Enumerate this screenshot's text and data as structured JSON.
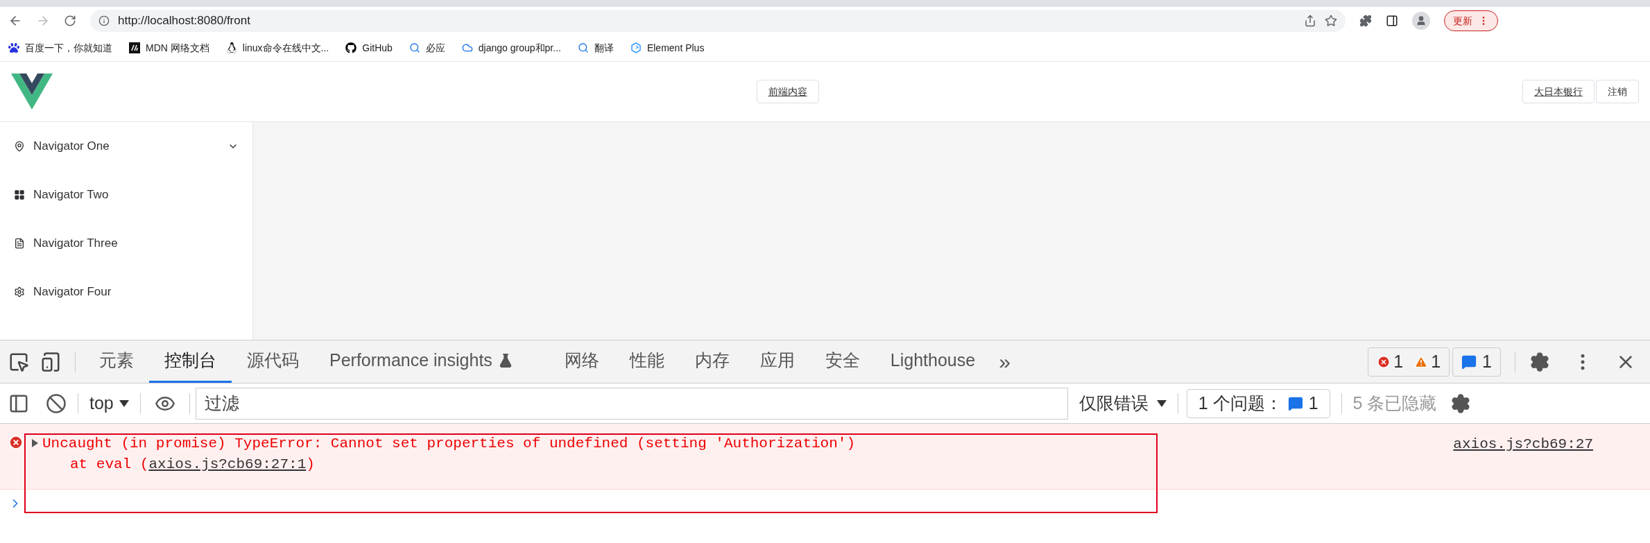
{
  "browser": {
    "url": "http://localhost:8080/front",
    "update_button": "更新"
  },
  "bookmarks": [
    {
      "label": "百度一下，你就知道"
    },
    {
      "label": "MDN 网络文档"
    },
    {
      "label": "linux命令在线中文..."
    },
    {
      "label": "GitHub"
    },
    {
      "label": "必应"
    },
    {
      "label": "django group和pr..."
    },
    {
      "label": "翻译"
    },
    {
      "label": "Element Plus"
    }
  ],
  "header": {
    "center_button": "前端内容",
    "user_button": "大日本银行",
    "logout_button": "注销"
  },
  "sidebar": {
    "items": [
      {
        "label": "Navigator One",
        "kind": "submenu"
      },
      {
        "label": "Navigator Two",
        "kind": "item"
      },
      {
        "label": "Navigator Three",
        "kind": "item"
      },
      {
        "label": "Navigator Four",
        "kind": "item"
      }
    ]
  },
  "devtools": {
    "tabs": [
      {
        "label": "元素",
        "selected": false
      },
      {
        "label": "控制台",
        "selected": true
      },
      {
        "label": "源代码",
        "selected": false
      },
      {
        "label": "Performance insights",
        "selected": false,
        "kind": "experiment"
      },
      {
        "label": "网络",
        "selected": false
      },
      {
        "label": "性能",
        "selected": false
      },
      {
        "label": "内存",
        "selected": false
      },
      {
        "label": "应用",
        "selected": false
      },
      {
        "label": "安全",
        "selected": false
      },
      {
        "label": "Lighthouse",
        "selected": false
      }
    ],
    "more_tabs": "»",
    "error_count": "1",
    "warning_count": "1",
    "message_count": "1",
    "console_toolbar": {
      "context": "top",
      "filter_placeholder": "过滤",
      "level": "仅限错误",
      "issues_label": "1 个问题：",
      "issues_count": "1",
      "hidden": "5 条已隐藏"
    },
    "messages": [
      {
        "kind": "error",
        "text": "Uncaught (in promise) TypeError: Cannot set properties of undefined (setting 'Authorization')",
        "stack_prefix": "at eval (",
        "stack_link": "axios.js?cb69:27:1",
        "stack_suffix": ")",
        "source": "axios.js?cb69:27"
      }
    ]
  }
}
